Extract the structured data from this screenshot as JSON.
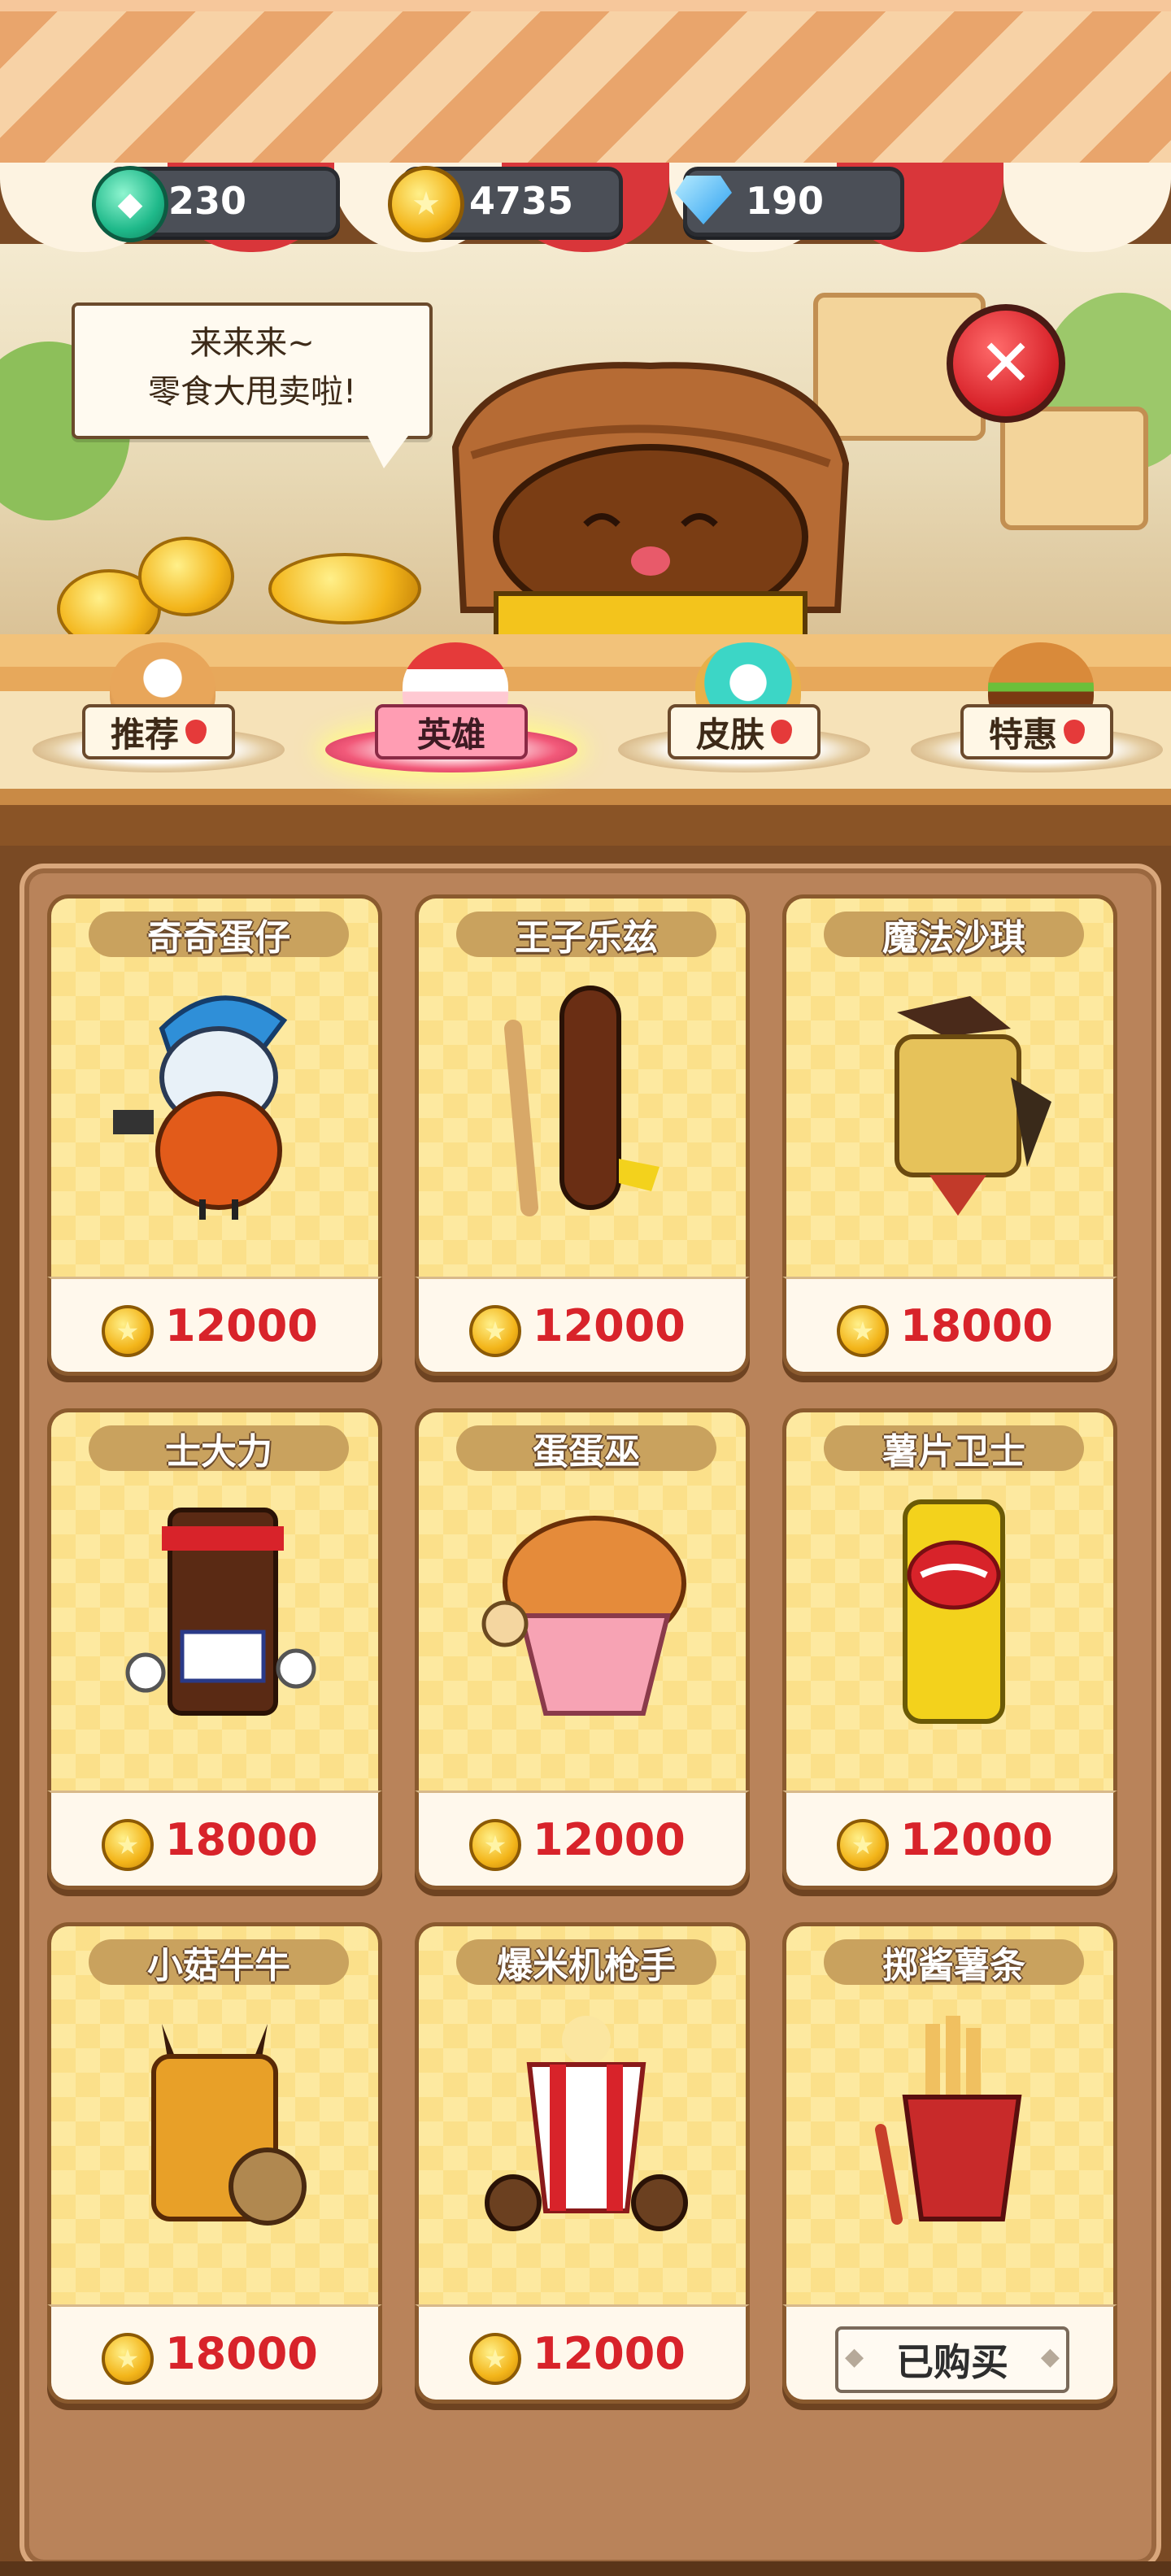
{
  "currencies": [
    {
      "name": "gem-currency",
      "icon": "green-gem-icon",
      "value": "230"
    },
    {
      "name": "gold-currency",
      "icon": "gold-coin-icon",
      "value": "4735"
    },
    {
      "name": "diamond-currency",
      "icon": "blue-diamond-icon",
      "value": "190"
    }
  ],
  "bubble": {
    "line1": "来来来~",
    "line2": "零食大甩卖啦!"
  },
  "close_icon": "close-icon",
  "tabs": [
    {
      "label": "推荐",
      "active": false
    },
    {
      "label": "英雄",
      "active": true
    },
    {
      "label": "皮肤",
      "active": false
    },
    {
      "label": "特惠",
      "active": false
    }
  ],
  "heroes": [
    {
      "name": "奇奇蛋仔",
      "price": "12000",
      "bought": false
    },
    {
      "name": "王子乐兹",
      "price": "12000",
      "bought": false
    },
    {
      "name": "魔法沙琪",
      "price": "18000",
      "bought": false
    },
    {
      "name": "士大力",
      "price": "18000",
      "bought": false
    },
    {
      "name": "蛋蛋巫",
      "price": "12000",
      "bought": false
    },
    {
      "name": "薯片卫士",
      "price": "12000",
      "bought": false
    },
    {
      "name": "小菇牛牛",
      "price": "18000",
      "bought": false
    },
    {
      "name": "爆米机枪手",
      "price": "12000",
      "bought": false
    },
    {
      "name": "掷酱薯条",
      "price": "",
      "bought": true,
      "bought_label": "已购买"
    }
  ],
  "colors": {
    "accent_red": "#d8232a",
    "panel": "#b9835a",
    "card": "#fde9a0"
  }
}
